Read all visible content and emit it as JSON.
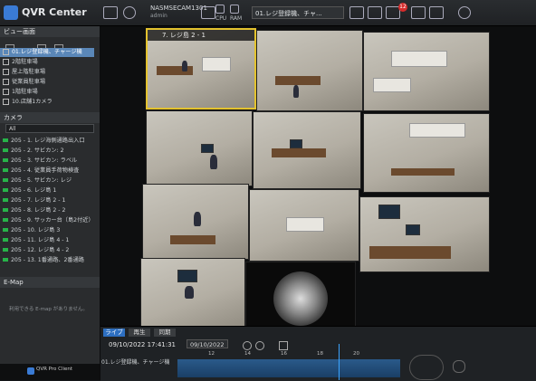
{
  "app": {
    "title": "QVR Center"
  },
  "topbar": {
    "nas_name": "NASMSECAM1301",
    "user": "admin",
    "view_selector": "01.レジ登録機、チャ...",
    "notification_count": "12",
    "labels": [
      "CPU",
      "RAM"
    ]
  },
  "sidebar": {
    "views_header": "ビュー画面",
    "views": [
      {
        "label": "01.レジ登録機、チャージ機",
        "selected": true
      },
      {
        "label": "2階駐車場",
        "selected": false
      },
      {
        "label": "屋上階駐車場",
        "selected": false
      },
      {
        "label": "従業員駐車場",
        "selected": false
      },
      {
        "label": "1階駐車場",
        "selected": false
      },
      {
        "label": "10.店舗1カメラ",
        "selected": false
      }
    ],
    "cameras_header": "カメラ",
    "camera_filter": "All",
    "cameras": [
      "205 - 1. レジ海側通路出入口",
      "205 - 2. サビカン: 2",
      "205 - 3. サビカン: ラベル",
      "205 - 4. 従業員手荷物検査",
      "205 - 5. サビカン: レジ",
      "205 - 6. レジ島 1",
      "205 - 7. レジ島 2 - 1",
      "205 - 8. レジ島 2 - 2",
      "205 - 9. サッカー台（島2付近）",
      "205 - 10. レジ島 3",
      "205 - 11. レジ島 4 - 1",
      "205 - 12. レジ島 4 - 2",
      "205 - 13. 1番通路、2番通路"
    ],
    "emap_header": "E-Map",
    "emap_empty": "利用できる E-map がありません。"
  },
  "grid": {
    "selected_tile_label": "7. レジ島 2 - 1"
  },
  "timeline": {
    "tabs": [
      "ライブ",
      "再生",
      "同期"
    ],
    "datetime": "09/10/2022 17:41:31",
    "date_field": "09/10/2022",
    "camera_row": "01.レジ登録機、チャージ機",
    "ticks": [
      "12",
      "14",
      "16",
      "18",
      "20"
    ]
  },
  "taskbar": {
    "label": "QVR Pro Client"
  }
}
